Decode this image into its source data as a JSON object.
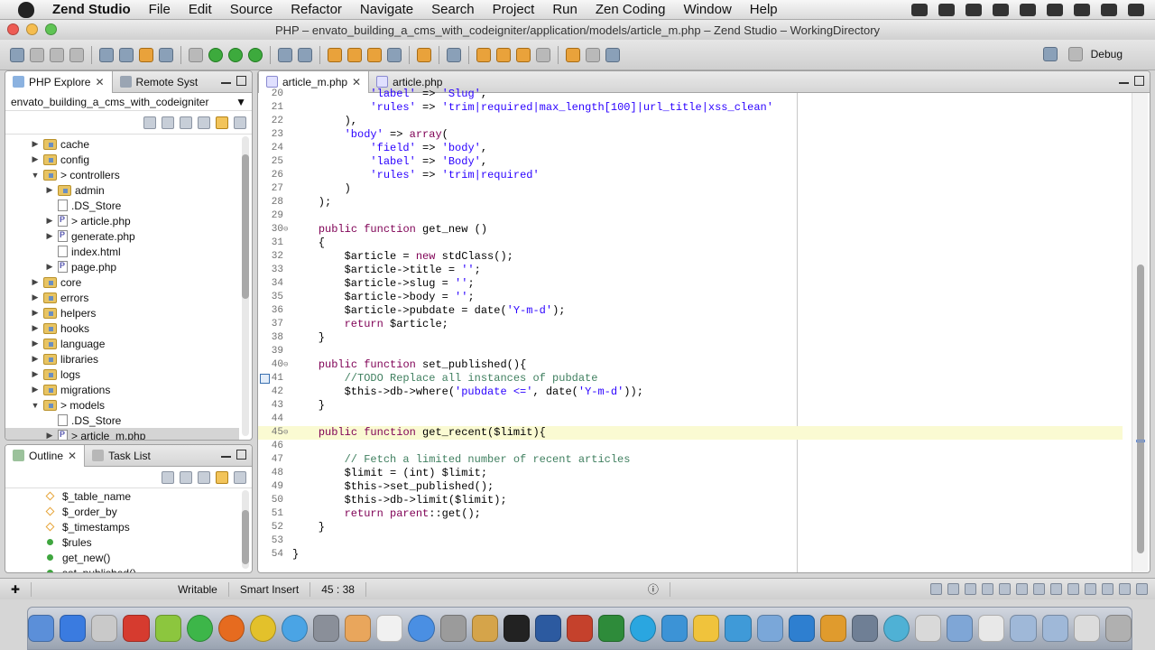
{
  "menubar": {
    "app_name": "Zend Studio",
    "items": [
      "File",
      "Edit",
      "Source",
      "Refactor",
      "Navigate",
      "Search",
      "Project",
      "Run",
      "Zen Coding",
      "Window",
      "Help"
    ]
  },
  "window": {
    "title": "PHP – envato_building_a_cms_with_codeigniter/application/models/article_m.php – Zend Studio – WorkingDirectory"
  },
  "toolbar": {
    "perspective_label": "Debug"
  },
  "explorer": {
    "tabs": [
      "PHP Explore",
      "Remote Syst"
    ],
    "project": "envato_building_a_cms_with_codeigniter",
    "tree": [
      {
        "label": "cache",
        "type": "folder",
        "depth": 0,
        "state": "collapsed"
      },
      {
        "label": "config",
        "type": "folder",
        "depth": 0,
        "state": "collapsed"
      },
      {
        "label": "> controllers",
        "type": "folder",
        "depth": 0,
        "state": "expanded"
      },
      {
        "label": "admin",
        "type": "folder",
        "depth": 1,
        "state": "collapsed"
      },
      {
        "label": ".DS_Store",
        "type": "file",
        "depth": 1,
        "state": "none"
      },
      {
        "label": "> article.php",
        "type": "php",
        "depth": 1,
        "state": "collapsed"
      },
      {
        "label": "generate.php",
        "type": "php",
        "depth": 1,
        "state": "collapsed"
      },
      {
        "label": "index.html",
        "type": "file",
        "depth": 1,
        "state": "none"
      },
      {
        "label": "page.php",
        "type": "php",
        "depth": 1,
        "state": "collapsed"
      },
      {
        "label": "core",
        "type": "folder",
        "depth": 0,
        "state": "collapsed"
      },
      {
        "label": "errors",
        "type": "folder",
        "depth": 0,
        "state": "collapsed"
      },
      {
        "label": "helpers",
        "type": "folder",
        "depth": 0,
        "state": "collapsed"
      },
      {
        "label": "hooks",
        "type": "folder",
        "depth": 0,
        "state": "collapsed"
      },
      {
        "label": "language",
        "type": "folder",
        "depth": 0,
        "state": "collapsed"
      },
      {
        "label": "libraries",
        "type": "folder",
        "depth": 0,
        "state": "collapsed"
      },
      {
        "label": "logs",
        "type": "folder",
        "depth": 0,
        "state": "collapsed"
      },
      {
        "label": "migrations",
        "type": "folder",
        "depth": 0,
        "state": "collapsed"
      },
      {
        "label": "> models",
        "type": "folder",
        "depth": 0,
        "state": "expanded"
      },
      {
        "label": ".DS_Store",
        "type": "file",
        "depth": 1,
        "state": "none"
      },
      {
        "label": "> article_m.php",
        "type": "php",
        "depth": 1,
        "state": "collapsed",
        "selected": true
      }
    ]
  },
  "outline": {
    "tabs": [
      "Outline",
      "Task List"
    ],
    "items": [
      {
        "label": "$_table_name",
        "kind": "field"
      },
      {
        "label": "$_order_by",
        "kind": "field"
      },
      {
        "label": "$_timestamps",
        "kind": "field"
      },
      {
        "label": "$rules",
        "kind": "method"
      },
      {
        "label": "get_new()",
        "kind": "method"
      },
      {
        "label": "set_published()",
        "kind": "method"
      }
    ]
  },
  "editor": {
    "tabs": [
      "article_m.php",
      "article.php"
    ],
    "active_tab": 0,
    "current_line": 45,
    "lines": [
      {
        "n": 20,
        "text": "            'label' => 'Slug',"
      },
      {
        "n": 21,
        "text": "            'rules' => 'trim|required|max_length[100]|url_title|xss_clean'"
      },
      {
        "n": 22,
        "text": "        ),"
      },
      {
        "n": 23,
        "text": "        'body' => array("
      },
      {
        "n": 24,
        "text": "            'field' => 'body',"
      },
      {
        "n": 25,
        "text": "            'label' => 'Body',"
      },
      {
        "n": 26,
        "text": "            'rules' => 'trim|required'"
      },
      {
        "n": 27,
        "text": "        )"
      },
      {
        "n": 28,
        "text": "    );"
      },
      {
        "n": 29,
        "text": ""
      },
      {
        "n": 30,
        "text": "    public function get_new ()",
        "fold": true
      },
      {
        "n": 31,
        "text": "    {"
      },
      {
        "n": 32,
        "text": "        $article = new stdClass();"
      },
      {
        "n": 33,
        "text": "        $article->title = '';"
      },
      {
        "n": 34,
        "text": "        $article->slug = '';"
      },
      {
        "n": 35,
        "text": "        $article->body = '';"
      },
      {
        "n": 36,
        "text": "        $article->pubdate = date('Y-m-d');"
      },
      {
        "n": 37,
        "text": "        return $article;"
      },
      {
        "n": 38,
        "text": "    }"
      },
      {
        "n": 39,
        "text": ""
      },
      {
        "n": 40,
        "text": "    public function set_published(){",
        "fold": true
      },
      {
        "n": 41,
        "text": "        //TODO Replace all instances of pubdate",
        "todo": true
      },
      {
        "n": 42,
        "text": "        $this->db->where('pubdate <=', date('Y-m-d'));"
      },
      {
        "n": 43,
        "text": "    }"
      },
      {
        "n": 44,
        "text": ""
      },
      {
        "n": 45,
        "text": "    public function get_recent($limit){",
        "fold": true
      },
      {
        "n": 46,
        "text": ""
      },
      {
        "n": 47,
        "text": "        // Fetch a limited number of recent articles"
      },
      {
        "n": 48,
        "text": "        $limit = (int) $limit;"
      },
      {
        "n": 49,
        "text": "        $this->set_published();"
      },
      {
        "n": 50,
        "text": "        $this->db->limit($limit);"
      },
      {
        "n": 51,
        "text": "        return parent::get();"
      },
      {
        "n": 52,
        "text": "    }"
      },
      {
        "n": 53,
        "text": ""
      },
      {
        "n": 54,
        "text": "}"
      }
    ]
  },
  "statusbar": {
    "mode": "Writable",
    "insert": "Smart Insert",
    "position": "45 : 38"
  },
  "colors": {
    "keyword": "#7f0055",
    "string": "#2a00ff",
    "comment": "#3f7f5f",
    "current_line": "#fafad2"
  }
}
